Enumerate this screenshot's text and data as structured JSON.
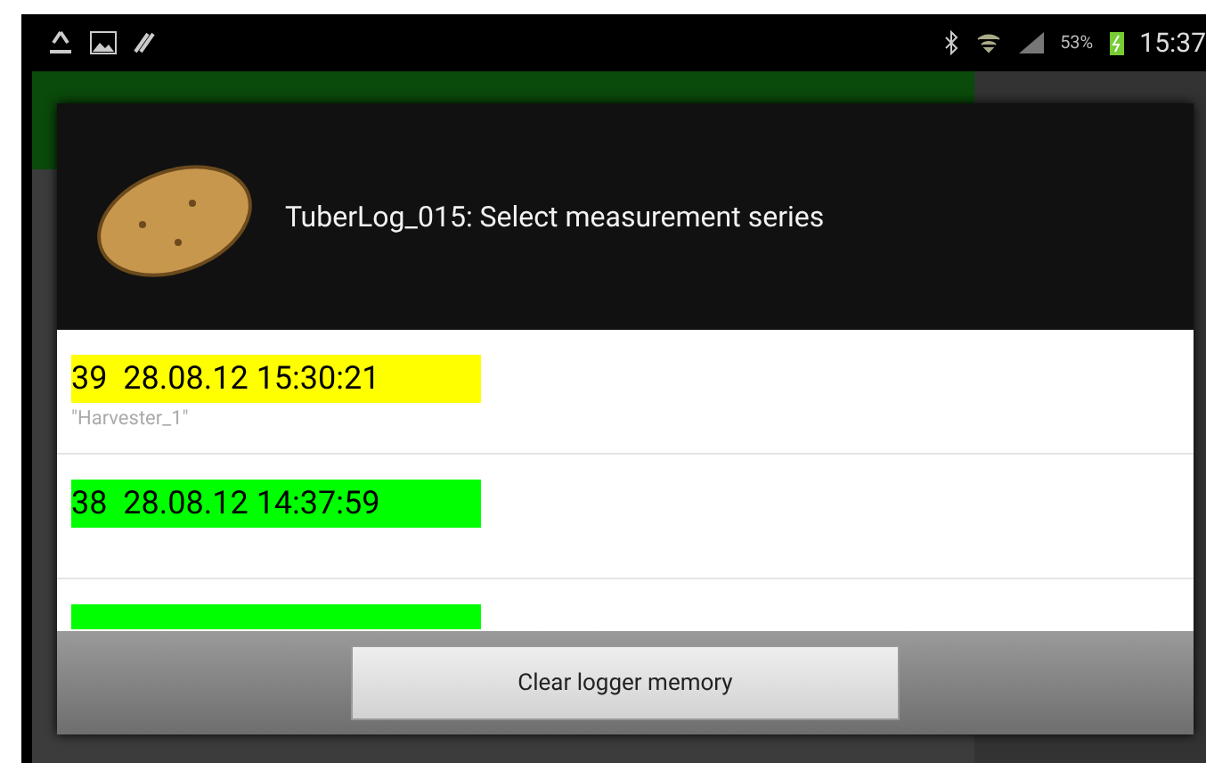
{
  "status_bar": {
    "battery": "53%",
    "time": "15:37"
  },
  "dialog": {
    "title": "TuberLog_015: Select measurement series",
    "series": [
      {
        "label": "39  28.08.12 15:30:21",
        "note": "\"Harvester_1\"",
        "color": "#ffff00"
      },
      {
        "label": "38  28.08.12 14:37:59",
        "color": "#00ff00"
      },
      {
        "color": "#00ff00"
      }
    ],
    "button": "Clear logger memory"
  }
}
